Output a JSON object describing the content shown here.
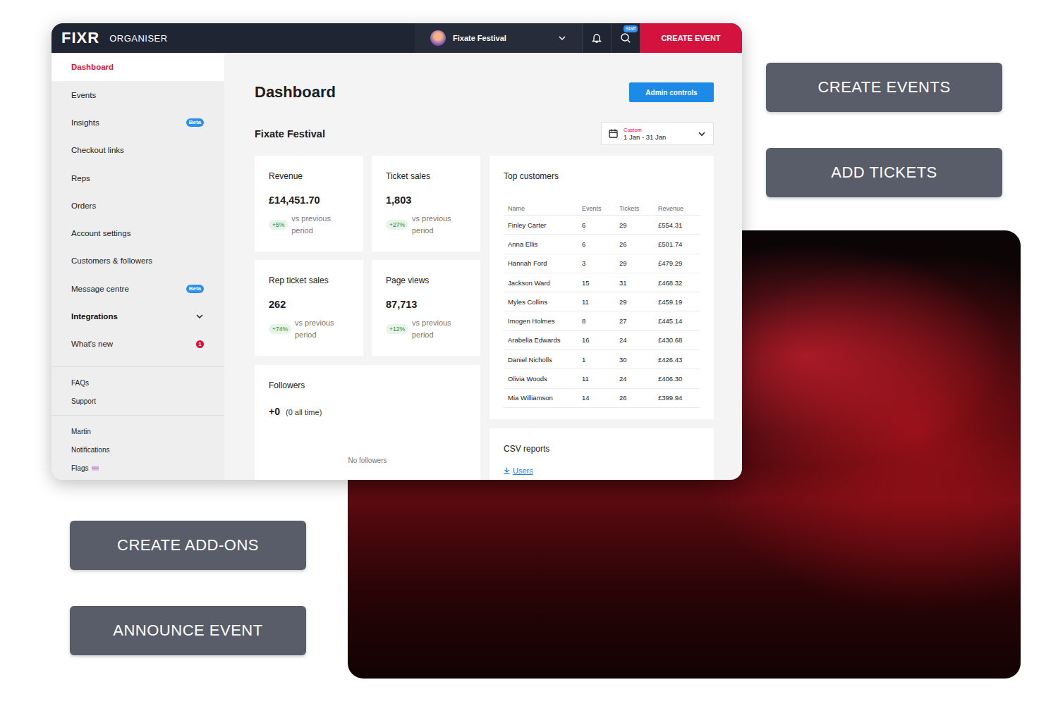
{
  "app_bar": {
    "logo": "FIXR",
    "product": "ORGANISER",
    "event": "Fixate Festival",
    "staff_badge": "Staff",
    "create_button": "CREATE EVENT"
  },
  "sidebar": {
    "items": [
      {
        "label": "Dashboard",
        "selected": true
      },
      {
        "label": "Events",
        "selected": false
      },
      {
        "label": "Insights",
        "selected": false,
        "badge": {
          "text": "Beta",
          "color": "#2d8ff0"
        }
      },
      {
        "label": "Checkout links",
        "selected": false
      },
      {
        "label": "Reps",
        "selected": false
      },
      {
        "label": "Orders",
        "selected": false
      },
      {
        "label": "Account settings",
        "selected": false
      },
      {
        "label": "Customers & followers",
        "selected": false
      },
      {
        "label": "Message centre",
        "selected": false,
        "badge": {
          "text": "Beta",
          "color": "#2d8ff0"
        }
      },
      {
        "label": "Integrations",
        "selected": false,
        "expanded": false
      },
      {
        "label": "What's new",
        "selected": false,
        "badge": {
          "text": "1",
          "color": "#d3123e"
        }
      }
    ],
    "help": [
      {
        "label": "FAQs",
        "kind": "plain"
      },
      {
        "label": "Support",
        "kind": "plain"
      }
    ],
    "account": [
      {
        "label": "Martin",
        "kind": "plain"
      },
      {
        "label": "Notifications",
        "kind": "plain"
      },
      {
        "label": "Flags",
        "kind": "flag"
      }
    ]
  },
  "main": {
    "title": "Dashboard",
    "admin_button": "Admin controls",
    "subtitle": "Fixate Festival",
    "date_range": {
      "label": "Custom",
      "value": "1 Jan - 31 Jan"
    }
  },
  "stats": [
    {
      "title": "Revenue",
      "value": "£14,451.70",
      "change": "+5%",
      "note": "vs previous period"
    },
    {
      "title": "Ticket sales",
      "value": "1,803",
      "change": "+27%",
      "note": "vs previous period"
    },
    {
      "title": "Rep ticket sales",
      "value": "262",
      "change": "+74%",
      "note": "vs previous period"
    },
    {
      "title": "Page views",
      "value": "87,713",
      "change": "+12%",
      "note": "vs previous period"
    }
  ],
  "followers": {
    "title": "Followers",
    "value": "+0",
    "note": "(0 all time)",
    "empty": "No followers"
  },
  "top_customers": {
    "title": "Top customers",
    "columns": [
      "Name",
      "Events",
      "Tickets",
      "Revenue"
    ],
    "rows": [
      [
        "Finley Carter",
        "6",
        "29",
        "£554.31"
      ],
      [
        "Anna Ellis",
        "6",
        "26",
        "£501.74"
      ],
      [
        "Hannah Ford",
        "3",
        "29",
        "£479.29"
      ],
      [
        "Jackson Ward",
        "15",
        "31",
        "£468.32"
      ],
      [
        "Myles Collins",
        "11",
        "29",
        "£459.19"
      ],
      [
        "Imogen Holmes",
        "8",
        "27",
        "£445.14"
      ],
      [
        "Arabella Edwards",
        "16",
        "24",
        "£430.68"
      ],
      [
        "Daniel Nicholls",
        "1",
        "30",
        "£426.43"
      ],
      [
        "Olivia Woods",
        "11",
        "24",
        "£406.30"
      ],
      [
        "Mia Williamson",
        "14",
        "26",
        "£399.94"
      ]
    ]
  },
  "csv_reports": {
    "title": "CSV reports",
    "links": [
      "Users"
    ]
  },
  "feature_buttons": {
    "right": [
      "CREATE EVENTS",
      "ADD TICKETS"
    ],
    "left": [
      "CREATE ADD-ONS",
      "ANNOUNCE EVENT"
    ]
  }
}
